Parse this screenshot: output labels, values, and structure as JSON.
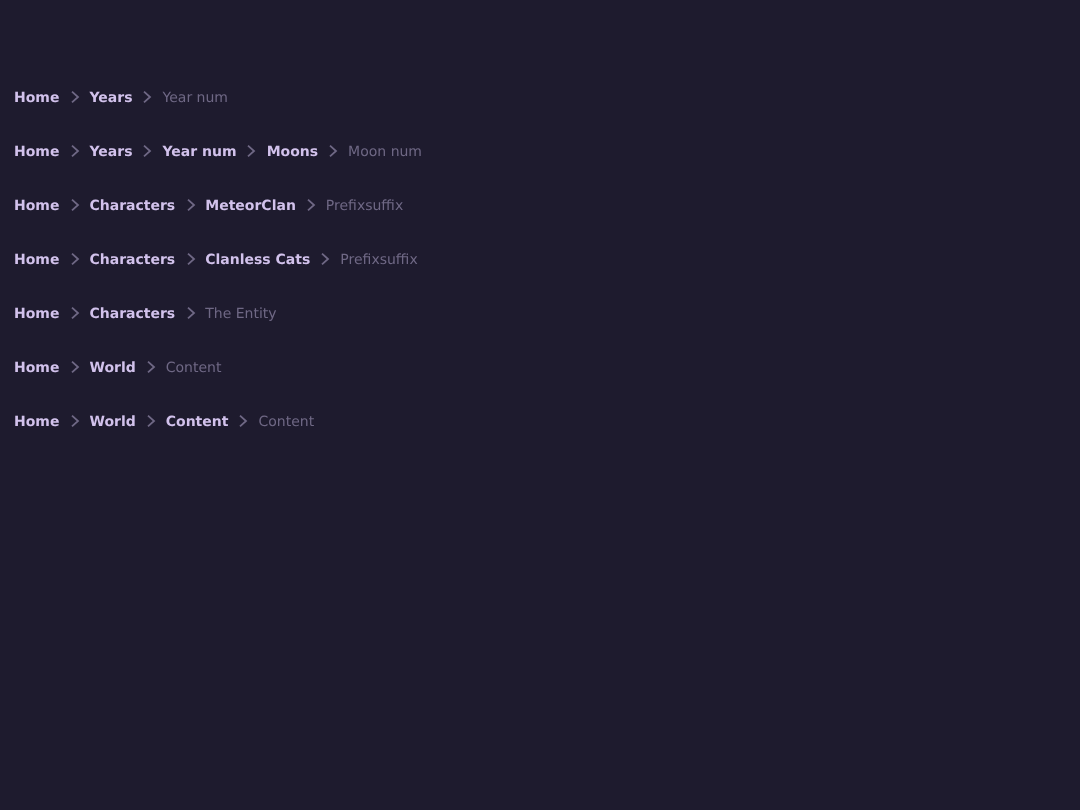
{
  "breadcrumbs": [
    {
      "items": [
        {
          "label": "Home",
          "current": false
        },
        {
          "label": "Years",
          "current": false
        },
        {
          "label": "Year num",
          "current": true
        }
      ]
    },
    {
      "items": [
        {
          "label": "Home",
          "current": false
        },
        {
          "label": "Years",
          "current": false
        },
        {
          "label": "Year num",
          "current": false
        },
        {
          "label": "Moons",
          "current": false
        },
        {
          "label": "Moon num",
          "current": true
        }
      ]
    },
    {
      "items": [
        {
          "label": "Home",
          "current": false
        },
        {
          "label": "Characters",
          "current": false
        },
        {
          "label": "MeteorClan",
          "current": false
        },
        {
          "label": "Prefixsuffix",
          "current": true
        }
      ]
    },
    {
      "items": [
        {
          "label": "Home",
          "current": false
        },
        {
          "label": "Characters",
          "current": false
        },
        {
          "label": "Clanless Cats",
          "current": false
        },
        {
          "label": "Prefixsuffix",
          "current": true
        }
      ]
    },
    {
      "items": [
        {
          "label": "Home",
          "current": false
        },
        {
          "label": "Characters",
          "current": false
        },
        {
          "label": "The Entity",
          "current": true
        }
      ]
    },
    {
      "items": [
        {
          "label": "Home",
          "current": false
        },
        {
          "label": "World",
          "current": false
        },
        {
          "label": "Content",
          "current": true
        }
      ]
    },
    {
      "items": [
        {
          "label": "Home",
          "current": false
        },
        {
          "label": "World",
          "current": false
        },
        {
          "label": "Content",
          "current": false
        },
        {
          "label": "Content",
          "current": true
        }
      ]
    }
  ]
}
